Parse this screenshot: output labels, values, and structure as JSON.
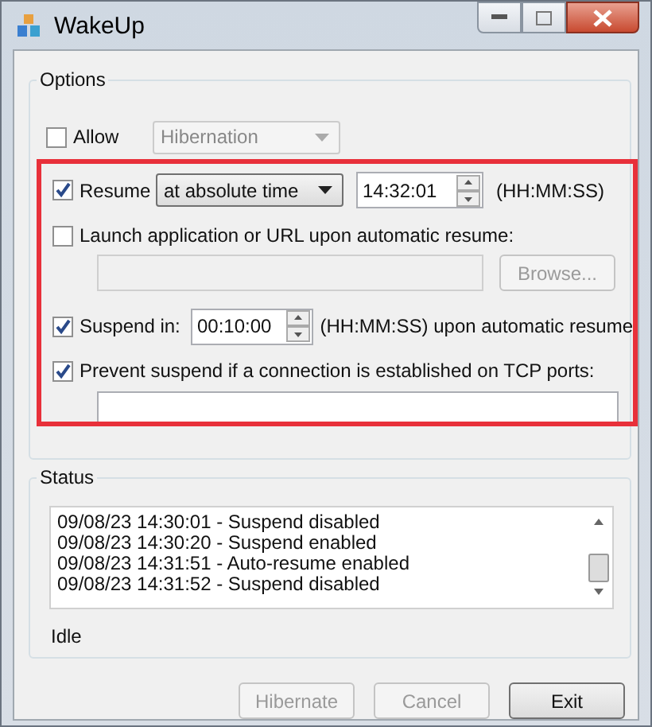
{
  "window": {
    "title": "WakeUp"
  },
  "options": {
    "title": "Options",
    "allow": {
      "label": "Allow",
      "checked": false,
      "dropdown": {
        "value": "Hibernation",
        "disabled": true
      }
    },
    "resume": {
      "label": "Resume",
      "checked": true,
      "mode": "at absolute time",
      "time": "14:32:01",
      "format": "(HH:MM:SS)"
    },
    "launch": {
      "label": "Launch application or URL upon automatic resume:",
      "checked": false,
      "browse": {
        "label": "Browse...",
        "disabled": true
      }
    },
    "suspend": {
      "label": "Suspend in:",
      "checked": true,
      "time": "00:10:00",
      "note": "(HH:MM:SS) upon automatic resume"
    },
    "prevent": {
      "label": "Prevent suspend if a connection is established on TCP ports:",
      "checked": true
    }
  },
  "status": {
    "title": "Status",
    "log": [
      "09/08/23 14:30:01 - Suspend disabled",
      "09/08/23 14:30:20 - Suspend enabled",
      "09/08/23 14:31:51 - Auto-resume enabled",
      "09/08/23 14:31:52 - Suspend disabled"
    ],
    "state": "Idle"
  },
  "buttons": [
    {
      "label": "Hibernate",
      "disabled": true
    },
    {
      "label": "Cancel",
      "disabled": true
    },
    {
      "label": "Exit",
      "disabled": false
    }
  ]
}
